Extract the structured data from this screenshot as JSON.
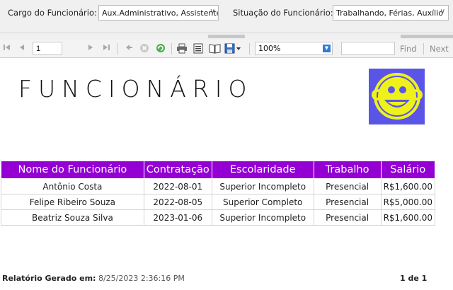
{
  "params": {
    "cargo_label": "Cargo do Funcionário:",
    "cargo_value": "Aux.Administrativo, Assistente",
    "situacao_label": "Situação do Funcionário:",
    "situacao_value": "Trabalhando, Férias, Auxílio"
  },
  "toolbar": {
    "page_number": "1",
    "zoom": "100%",
    "find_label": "Find",
    "next_label": "Next",
    "icons": [
      "first-page-icon",
      "previous-page-icon",
      "next-page-icon",
      "last-page-icon",
      "back-icon",
      "stop-icon",
      "refresh-icon",
      "print-icon",
      "print-layout-icon",
      "page-setup-icon",
      "export-icon"
    ]
  },
  "report": {
    "title": "FUNCIONÁRIO",
    "logo_color": "#5a55e6",
    "header_color": "#9400d3",
    "columns": [
      "Nome do Funcionário",
      "Contratação",
      "Escolaridade",
      "Trabalho",
      "Salário"
    ],
    "rows": [
      [
        "Antônio Costa",
        "2022-08-01",
        "Superior Incompleto",
        "Presencial",
        "R$1,600.00"
      ],
      [
        "Felipe Ribeiro Souza",
        "2022-08-05",
        "Superior Completo",
        "Presencial",
        "R$5,000.00"
      ],
      [
        "Beatriz Souza Silva",
        "2023-01-06",
        "Superior Incompleto",
        "Presencial",
        "R$1,600.00"
      ]
    ]
  },
  "footer": {
    "generated_label": "Relatório Gerado em:",
    "generated_value": "8/25/2023 2:36:16 PM",
    "page_indicator": "1 de 1"
  }
}
